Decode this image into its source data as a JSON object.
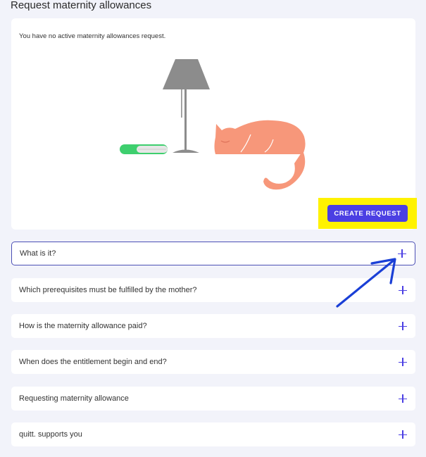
{
  "page": {
    "title": "Request maternity allowances"
  },
  "card": {
    "message": "You have no active maternity allowances request.",
    "cta_label": "CREATE REQUEST"
  },
  "faq": [
    {
      "label": "What is it?",
      "active": true
    },
    {
      "label": "Which prerequisites must be fulfilled by the mother?"
    },
    {
      "label": "How is the maternity allowance paid?"
    },
    {
      "label": "When does the entitlement begin and end?"
    },
    {
      "label": "Requesting maternity allowance"
    },
    {
      "label": "quitt. supports you"
    }
  ],
  "colors": {
    "accent": "#4b3fe3",
    "highlight": "#fff200",
    "annotation_arrow": "#1a3fd6",
    "cat": "#f7977a",
    "lamp": "#8c8c8c",
    "book_green": "#3ecf6e"
  }
}
